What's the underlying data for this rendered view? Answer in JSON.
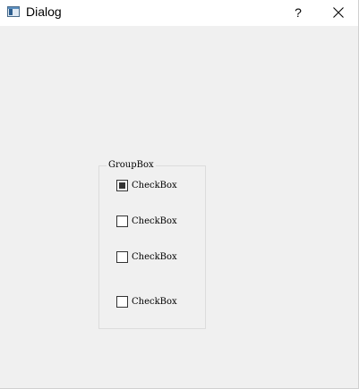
{
  "window": {
    "title": "Dialog",
    "help_label": "?",
    "close_label": "close"
  },
  "groupbox": {
    "title": "GroupBox",
    "checkboxes": [
      {
        "label": "CheckBox",
        "checked": true
      },
      {
        "label": "CheckBox",
        "checked": false
      },
      {
        "label": "CheckBox",
        "checked": false
      },
      {
        "label": "CheckBox",
        "checked": false
      }
    ]
  },
  "icons": {
    "app": "window-icon",
    "close": "close-icon"
  }
}
